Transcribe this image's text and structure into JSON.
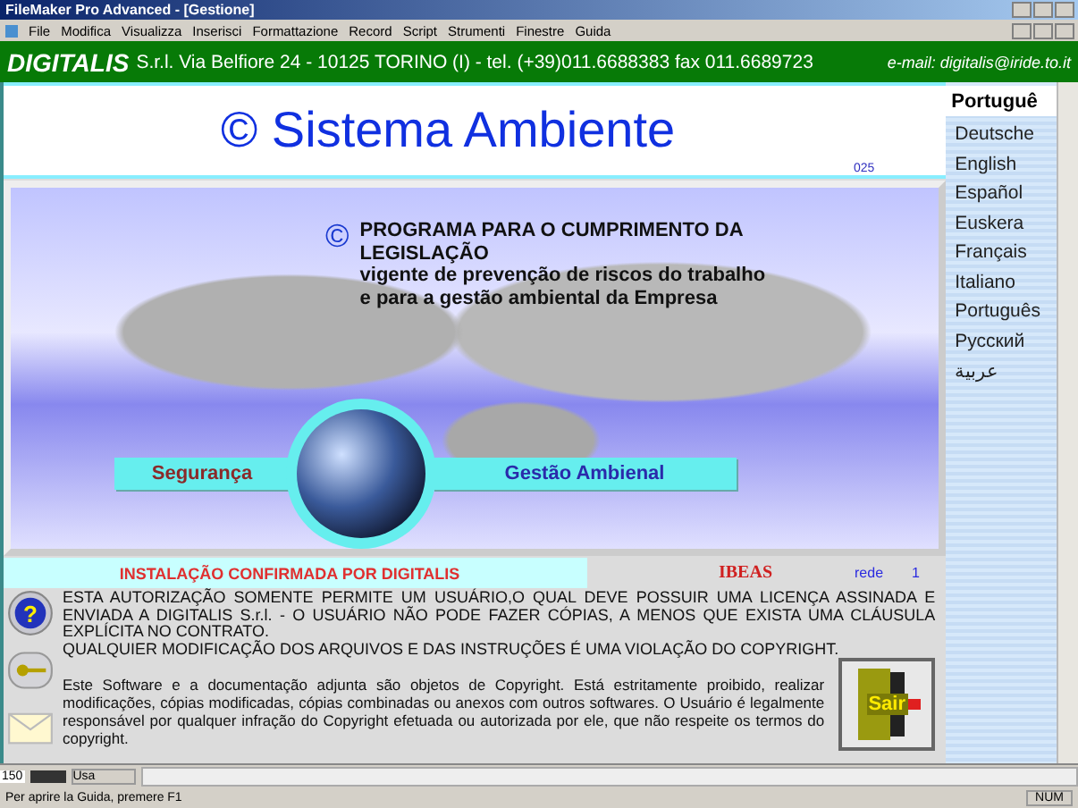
{
  "window": {
    "title": "FileMaker Pro Advanced - [Gestione]"
  },
  "menu": [
    "File",
    "Modifica",
    "Visualizza",
    "Inserisci",
    "Formattazione",
    "Record",
    "Script",
    "Strumenti",
    "Finestre",
    "Guida"
  ],
  "header": {
    "brand": "DIGITALIS",
    "address": "S.r.l. Via Belfiore 24 - 10125 TORINO (I) - tel. (+39)011.6688383  fax 011.6689723",
    "email": "e-mail: digitalis@iride.to.it"
  },
  "title_block": {
    "title": "© Sistema Ambiente",
    "code": "025"
  },
  "banner": {
    "copyright_mark": "©",
    "heading": "PROGRAMA PARA O CUMPRIMENTO DA LEGISLAÇÃO",
    "lines": [
      "vigente de prevenção de riscos do trabalho",
      "e  para a gestão ambiental da Empresa"
    ],
    "buttons": [
      {
        "label": "Segurança",
        "kind": "safety"
      },
      {
        "label": "Gestão Ambienal",
        "kind": "environment"
      }
    ]
  },
  "install_strip": {
    "text": "INSTALAÇÃO CONFIRMADA POR DIGITALIS",
    "client": "IBEAS",
    "network_label": "rede",
    "network_count": "1"
  },
  "notice": {
    "warning": "ESTA AUTORIZAÇÃO SOMENTE PERMITE UM USUÁRIO,O QUAL DEVE POSSUIR UMA LICENÇA ASSINADA E ENVIADA A DIGITALIS S.r.l. - O USUÁRIO NÃO PODE FAZER CÓPIAS, A MENOS QUE EXISTA UMA CLÁUSULA EXPLÍCITA NO CONTRATO.",
    "violation": "QUALQUIER MODIFICAÇÃO DOS ARQUIVOS E DAS INSTRUÇÕES É UMA VIOLAÇÃO DO COPYRIGHT.",
    "copyright": "Este Software e a documentação adjunta são objetos de Copyright. Está estritamente proibido, realizar modificações, cópias modificadas, cópias combinadas ou anexos com outros softwares. O Usuário é legalmente responsável por qualquer infração do Copyright efetuada ou autorizada por ele,  que não respeite os termos do copyright."
  },
  "exit_button": {
    "label": "Sair"
  },
  "help_icon_glyph": "?",
  "languages": {
    "current": "Portuguê",
    "items": [
      "Deutsche",
      "English",
      "Español",
      "Euskera",
      "Français",
      "Italiano",
      "Português",
      "Русский",
      "عربية"
    ]
  },
  "bottom_bar": {
    "zoom": "150",
    "mode": "Usa"
  },
  "status_bar": {
    "hint": "Per aprire la Guida, premere F1",
    "num": "NUM"
  }
}
